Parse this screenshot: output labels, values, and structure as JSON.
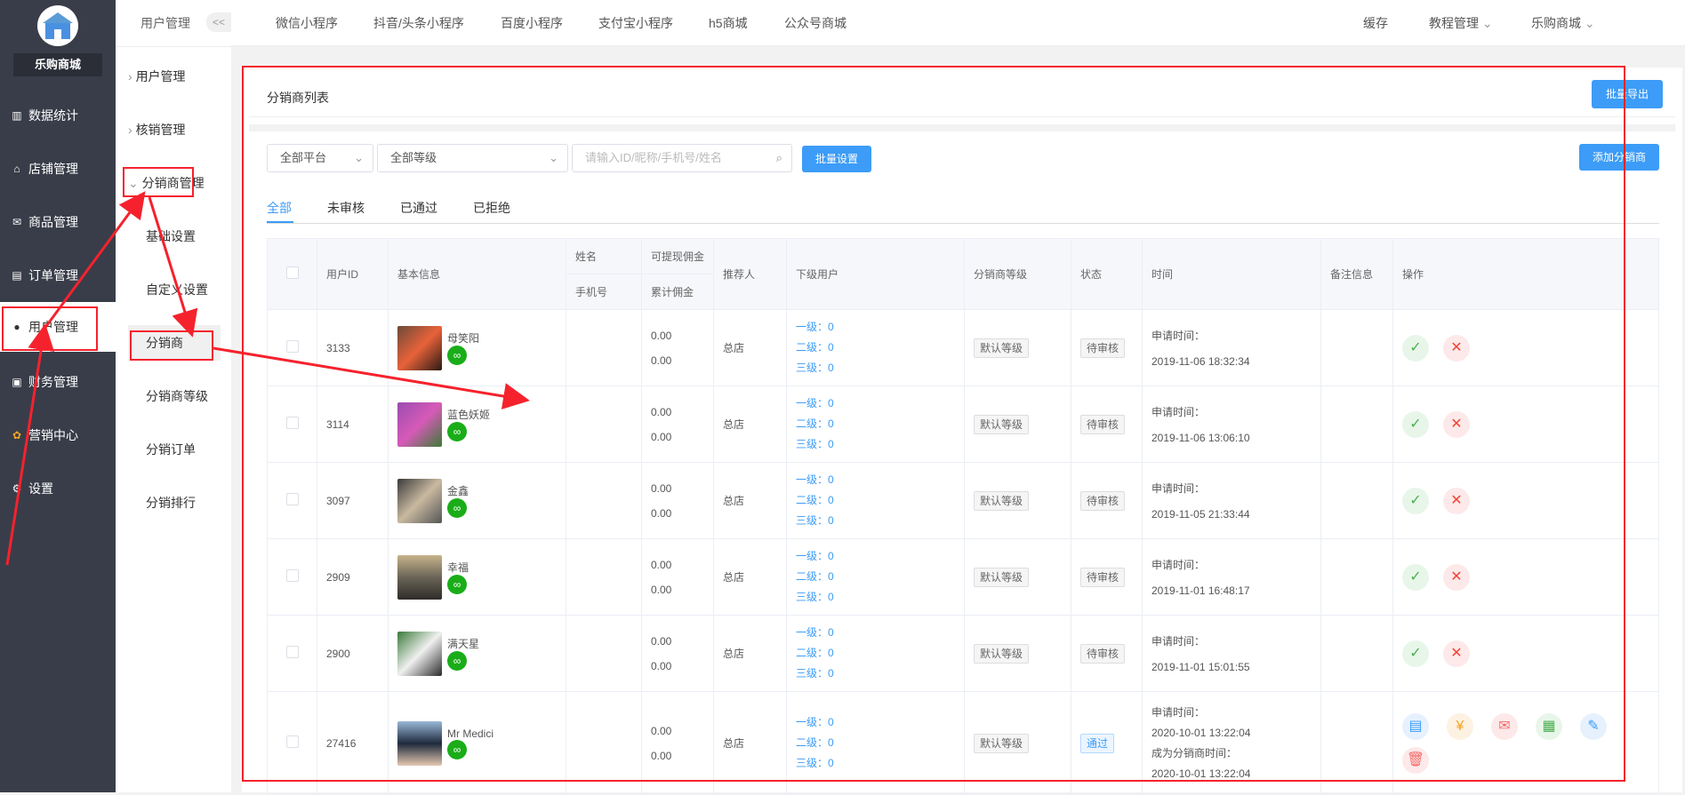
{
  "sidebar": {
    "brand": "乐购商城",
    "items": [
      {
        "label": "数据统计",
        "icon": "chart-icon"
      },
      {
        "label": "店铺管理",
        "icon": "shop-icon"
      },
      {
        "label": "商品管理",
        "icon": "goods-icon"
      },
      {
        "label": "订单管理",
        "icon": "order-icon"
      },
      {
        "label": "用户管理",
        "icon": "user-icon"
      },
      {
        "label": "财务管理",
        "icon": "finance-icon"
      },
      {
        "label": "营销中心",
        "icon": "marketing-icon"
      },
      {
        "label": "设置",
        "icon": "settings-icon"
      }
    ]
  },
  "subnav": {
    "title": "用户管理",
    "collapse": "<<",
    "items": [
      "用户管理",
      "核销管理",
      "分销商管理",
      "基础设置",
      "自定义设置",
      "分销商",
      "分销商等级",
      "分销订单",
      "分销排行"
    ]
  },
  "topnav": {
    "items": [
      "微信小程序",
      "抖音/头条小程序",
      "百度小程序",
      "支付宝小程序",
      "h5商城",
      "公众号商城"
    ],
    "right": [
      "缓存",
      "教程管理",
      "乐购商城"
    ]
  },
  "card": {
    "title": "分销商列表",
    "export": "批量导出"
  },
  "filters": {
    "platform": "全部平台",
    "level": "全部等级",
    "search_placeholder": "请输入ID/昵称/手机号/姓名",
    "batch": "批量设置",
    "add": "添加分销商"
  },
  "tabs": [
    "全部",
    "未审核",
    "已通过",
    "已拒绝"
  ],
  "table": {
    "headers": {
      "uid": "用户ID",
      "basic": "基本信息",
      "name": "姓名",
      "phone": "手机号",
      "withdraw": "可提现佣金",
      "total": "累计佣金",
      "referrer": "推荐人",
      "sub": "下级用户",
      "level": "分销商等级",
      "status": "状态",
      "time": "时间",
      "remark": "备注信息",
      "op": "操作"
    },
    "rows": [
      {
        "id": "3133",
        "nick": "母笑阳",
        "c1": "0.00",
        "c2": "0.00",
        "ref": "总店",
        "l1": "一级：0",
        "l2": "二级：0",
        "l3": "三级：0",
        "level": "默认等级",
        "status": "待审核",
        "t1": "申请时间：",
        "t2": "2019-11-06 18:32:34"
      },
      {
        "id": "3114",
        "nick": "蓝色妖姬",
        "c1": "0.00",
        "c2": "0.00",
        "ref": "总店",
        "l1": "一级：0",
        "l2": "二级：0",
        "l3": "三级：0",
        "level": "默认等级",
        "status": "待审核",
        "t1": "申请时间：",
        "t2": "2019-11-06 13:06:10"
      },
      {
        "id": "3097",
        "nick": "金鑫",
        "c1": "0.00",
        "c2": "0.00",
        "ref": "总店",
        "l1": "一级：0",
        "l2": "二级：0",
        "l3": "三级：0",
        "level": "默认等级",
        "status": "待审核",
        "t1": "申请时间：",
        "t2": "2019-11-05 21:33:44"
      },
      {
        "id": "2909",
        "nick": "幸福",
        "c1": "0.00",
        "c2": "0.00",
        "ref": "总店",
        "l1": "一级：0",
        "l2": "二级：0",
        "l3": "三级：0",
        "level": "默认等级",
        "status": "待审核",
        "t1": "申请时间：",
        "t2": "2019-11-01 16:48:17"
      },
      {
        "id": "2900",
        "nick": "满天星",
        "c1": "0.00",
        "c2": "0.00",
        "ref": "总店",
        "l1": "一级：0",
        "l2": "二级：0",
        "l3": "三级：0",
        "level": "默认等级",
        "status": "待审核",
        "t1": "申请时间：",
        "t2": "2019-11-01 15:01:55"
      },
      {
        "id": "27416",
        "nick": "Mr Medici",
        "c1": "0.00",
        "c2": "0.00",
        "ref": "总店",
        "l1": "一级：0",
        "l2": "二级：0",
        "l3": "三级：0",
        "level": "默认等级",
        "status": "通过",
        "t1": "申请时间：",
        "t2": "2020-10-01 13:22:04",
        "t3": "成为分销商时间：",
        "t4": "2020-10-01 13:22:04"
      }
    ]
  }
}
